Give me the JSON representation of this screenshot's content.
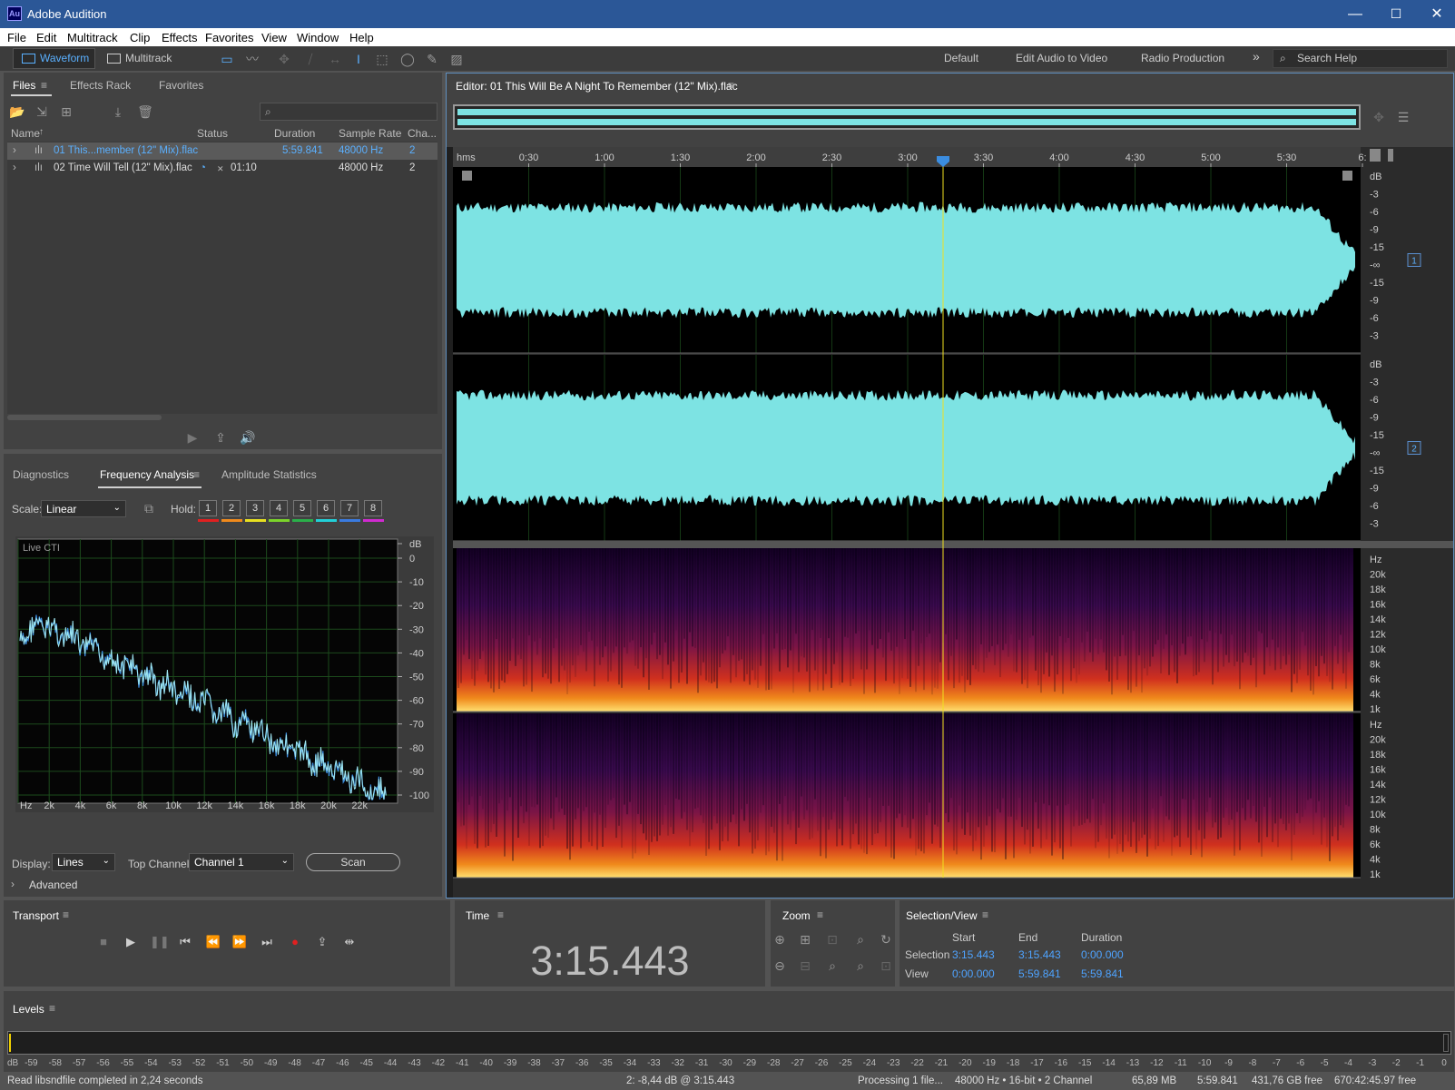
{
  "window": {
    "app_badge": "Au",
    "title": "Adobe Audition",
    "minimize": "—",
    "maximize": "☐",
    "close": "✕"
  },
  "menu": [
    "File",
    "Edit",
    "Multitrack",
    "Clip",
    "Effects",
    "Favorites",
    "View",
    "Window",
    "Help"
  ],
  "toolbar": {
    "waveform": "Waveform",
    "multitrack": "Multitrack",
    "workspaces": [
      "Default",
      "Edit Audio to Video",
      "Radio Production"
    ],
    "more": "»",
    "search_placeholder": "Search Help"
  },
  "files_panel": {
    "tabs": [
      "Files",
      "Effects Rack",
      "Favorites"
    ],
    "columns": [
      "Name",
      "Status",
      "Duration",
      "Sample Rate",
      "Cha..."
    ],
    "rows": [
      {
        "name": "01 This...member (12\" Mix).flac",
        "status": "",
        "duration": "5:59.841",
        "rate": "48000 Hz",
        "channels": "2"
      },
      {
        "name": "02 Time Will Tell (12\" Mix).flac",
        "status": "01:10",
        "duration": "",
        "rate": "48000 Hz",
        "channels": "2"
      }
    ]
  },
  "analysis": {
    "tabs": [
      "Diagnostics",
      "Frequency Analysis",
      "Amplitude Statistics"
    ],
    "scale_label": "Scale:",
    "scale_value": "Linear",
    "hold_label": "Hold:",
    "hold": [
      "1",
      "2",
      "3",
      "4",
      "5",
      "6",
      "7",
      "8"
    ],
    "hold_colors": [
      "#e02020",
      "#f08a1c",
      "#e8e020",
      "#7bd42a",
      "#2ab04a",
      "#22d0d8",
      "#3a7be0",
      "#d02ad0"
    ],
    "graph_label": "Live CTI",
    "db_labels": [
      "dB",
      "0",
      "-10",
      "-20",
      "-30",
      "-40",
      "-50",
      "-60",
      "-70",
      "-80",
      "-90",
      "-100"
    ],
    "hz_labels": [
      "Hz",
      "2k",
      "4k",
      "6k",
      "8k",
      "10k",
      "12k",
      "14k",
      "16k",
      "18k",
      "20k",
      "22k"
    ],
    "display_label": "Display:",
    "display_value": "Lines",
    "top_channel_label": "Top Channel:",
    "top_channel_value": "Channel 1",
    "scan": "Scan",
    "advanced": "Advanced"
  },
  "editor": {
    "title": "Editor: 01 This Will Be A Night To Remember (12\" Mix).flac",
    "ruler": [
      "hms",
      "0:30",
      "1:00",
      "1:30",
      "2:00",
      "2:30",
      "3:00",
      "3:30",
      "4:00",
      "4:30",
      "5:00",
      "5:30",
      "6:"
    ],
    "db_scale": [
      "dB",
      "-3",
      "-6",
      "-9",
      "-15",
      "-∞",
      "-15",
      "-9",
      "-6",
      "-3"
    ],
    "channel_badges": [
      "1",
      "2"
    ],
    "hz_scale": [
      "Hz",
      "20k",
      "18k",
      "16k",
      "14k",
      "12k",
      "10k",
      "8k",
      "6k",
      "4k",
      "1k"
    ],
    "waveform_color": "#7de3e3"
  },
  "transport": {
    "title": "Transport"
  },
  "time": {
    "title": "Time",
    "value": "3:15.443"
  },
  "zoom": {
    "title": "Zoom"
  },
  "selection": {
    "title": "Selection/View",
    "cols": [
      "Start",
      "End",
      "Duration"
    ],
    "selection_label": "Selection",
    "view_label": "View",
    "sel": [
      "3:15.443",
      "3:15.443",
      "0:00.000"
    ],
    "view": [
      "0:00.000",
      "5:59.841",
      "5:59.841"
    ]
  },
  "levels": {
    "title": "Levels",
    "ticks": [
      "dB",
      "-59",
      "-58",
      "-57",
      "-56",
      "-55",
      "-54",
      "-53",
      "-52",
      "-51",
      "-50",
      "-49",
      "-48",
      "-47",
      "-46",
      "-45",
      "-44",
      "-43",
      "-42",
      "-41",
      "-40",
      "-39",
      "-38",
      "-37",
      "-36",
      "-35",
      "-34",
      "-33",
      "-32",
      "-31",
      "-30",
      "-29",
      "-28",
      "-27",
      "-26",
      "-25",
      "-24",
      "-23",
      "-22",
      "-21",
      "-20",
      "-19",
      "-18",
      "-17",
      "-16",
      "-15",
      "-14",
      "-13",
      "-12",
      "-11",
      "-10",
      "-9",
      "-8",
      "-7",
      "-6",
      "-5",
      "-4",
      "-3",
      "-2",
      "-1",
      "0"
    ]
  },
  "status": {
    "left": "Read libsndfile completed in 2,24 seconds",
    "cursor": "2: -8,44 dB @ 3:15.443",
    "processing": "Processing 1 file...",
    "format": "48000 Hz • 16-bit • 2 Channel",
    "size": "65,89 MB",
    "duration": "5:59.841",
    "free": "431,76 GB free",
    "free_time": "670:42:45.97 free"
  }
}
